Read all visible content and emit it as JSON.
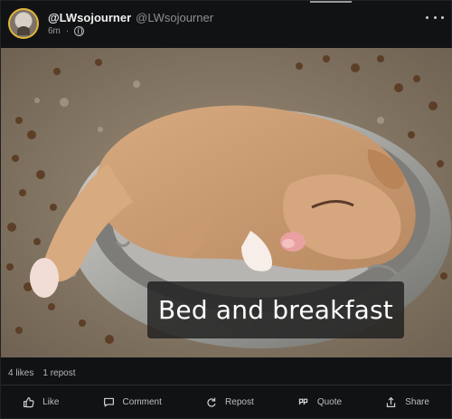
{
  "post": {
    "author_display": "@LWsojourner",
    "author_handle": "@LWsojourner",
    "timestamp": "6m",
    "privacy_icon": "globe-icon",
    "menu_icon": "more-dots-icon",
    "caption": "Bed and breakfast",
    "stats": {
      "likes": "4 likes",
      "reposts": "1 repost"
    },
    "actions": [
      {
        "label": "Like",
        "icon": "thumbs-up-icon"
      },
      {
        "label": "Comment",
        "icon": "comment-icon"
      },
      {
        "label": "Repost",
        "icon": "repost-icon"
      },
      {
        "label": "Quote",
        "icon": "quote-icon"
      },
      {
        "label": "Share",
        "icon": "share-icon"
      }
    ]
  },
  "colors": {
    "background": "#111214",
    "avatar_ring": "#e2b53a",
    "caption_bg": "#1e1e1e",
    "text": "#e6e6e6"
  }
}
